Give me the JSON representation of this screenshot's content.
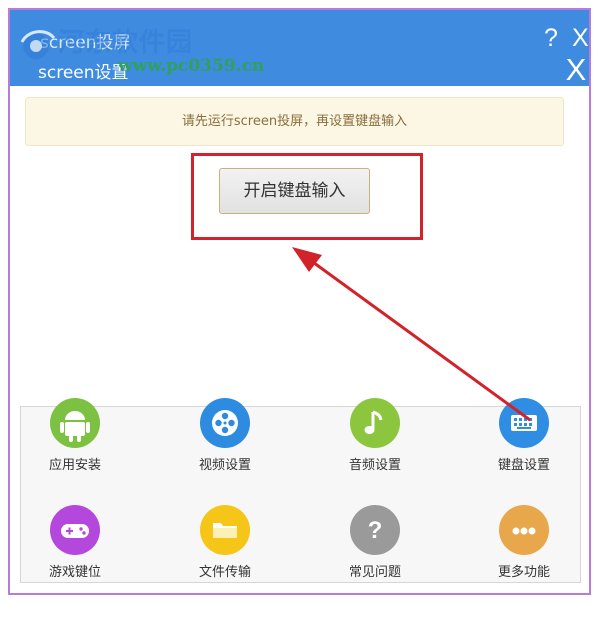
{
  "header": {
    "behind_title": "screen投屏",
    "title": "screen设置",
    "help_label": "?",
    "close_back_label": "X",
    "close_label": "X",
    "watermark_name": "河东软件园",
    "watermark_url": "www.pc0359.cn"
  },
  "notice": {
    "text": "请先运行screen投屏，再设置键盘输入"
  },
  "main": {
    "enable_keyboard_label": "开启键盘输入"
  },
  "features": [
    {
      "label": "应用安装",
      "icon": "android-icon",
      "color": "#7cc142"
    },
    {
      "label": "视频设置",
      "icon": "film-reel-icon",
      "color": "#2d8be0"
    },
    {
      "label": "音频设置",
      "icon": "music-note-icon",
      "color": "#8cc63f"
    },
    {
      "label": "键盘设置",
      "icon": "keyboard-icon",
      "color": "#2f8de4"
    },
    {
      "label": "游戏键位",
      "icon": "gamepad-icon",
      "color": "#b548dc"
    },
    {
      "label": "文件传输",
      "icon": "folder-icon",
      "color": "#f5c518"
    },
    {
      "label": "常见问题",
      "icon": "question-icon",
      "color": "#9a9a9a"
    },
    {
      "label": "更多功能",
      "icon": "more-dots-icon",
      "color": "#e8a74a"
    }
  ],
  "colors": {
    "header": "#3f8be0",
    "frame": "#b67bdc",
    "highlight": "#d2232a",
    "arrow": "#d2232a"
  }
}
